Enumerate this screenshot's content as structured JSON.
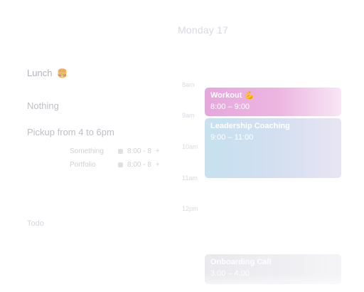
{
  "planner": {
    "lunch": {
      "label": "Lunch",
      "emoji": "🍔"
    },
    "nothing": {
      "label": "Nothing"
    },
    "pickup": {
      "label": "Pickup from 4 to 6pm"
    },
    "subtasks": [
      {
        "label": "Something",
        "meta": "8:00 - 8"
      },
      {
        "label": "Portfolio",
        "meta": "8:00 - 8"
      }
    ],
    "todo": {
      "label": "Todo"
    }
  },
  "calendar": {
    "day_header": "Monday 17",
    "hours": [
      "8am",
      "9am",
      "10am",
      "11am",
      "12pm"
    ],
    "events": {
      "workout": {
        "title": "Workout",
        "emoji": "💪",
        "time": "8:00 – 9:00",
        "color": "#e6a7dc"
      },
      "coaching": {
        "title": "Leadership Coaching",
        "time": "9:00 – 11:00",
        "color": "#c6e1ef"
      },
      "onboarding": {
        "title": "Onboarding Call",
        "time": "3:00 – 4:00",
        "color": "#d4d2dc"
      }
    }
  }
}
